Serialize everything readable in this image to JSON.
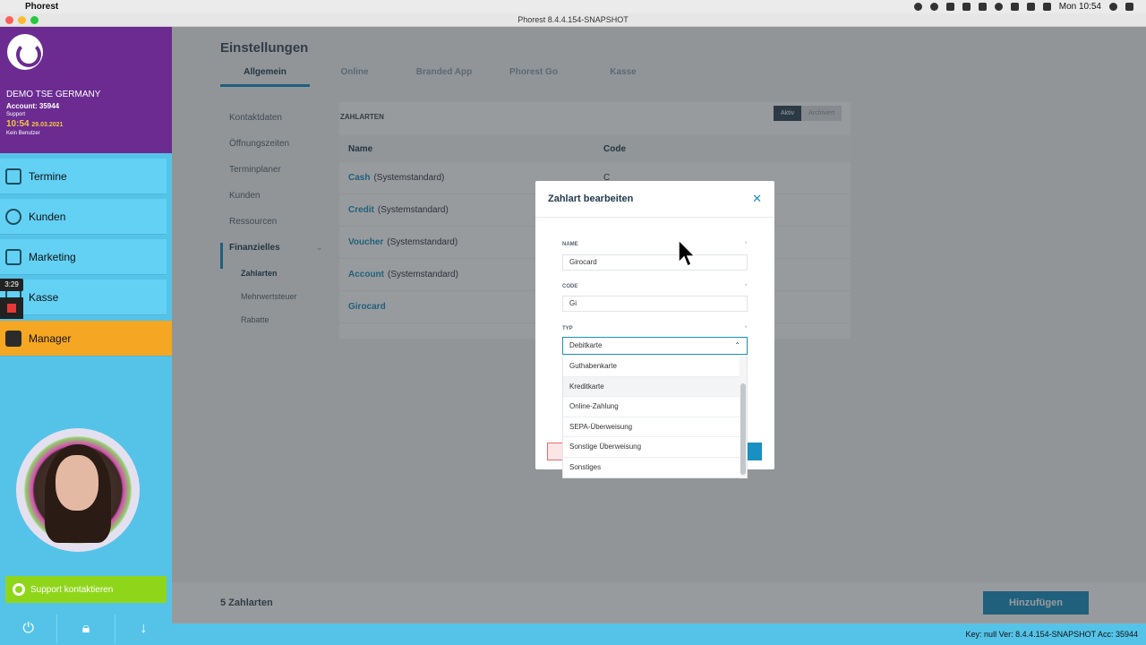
{
  "menubar": {
    "app_name": "Phorest",
    "clock": "Mon 10:54"
  },
  "window": {
    "title": "Phorest 8.4.4.154-SNAPSHOT"
  },
  "sidebar": {
    "company": "DEMO TSE GERMANY",
    "account": "Account: 35944",
    "role": "Support",
    "time": "10:54",
    "date": "29.03.2021",
    "user": "Kein Benutzer",
    "nav": [
      {
        "label": "Termine"
      },
      {
        "label": "Kunden"
      },
      {
        "label": "Marketing"
      },
      {
        "label": "Kasse"
      },
      {
        "label": "Manager"
      }
    ],
    "recording_time": "3:29",
    "support_button": "Support kontaktieren",
    "accent_manager": "#f5a623",
    "accent_head": "#6b2b91"
  },
  "main": {
    "title": "Einstellungen",
    "tabs": [
      "Allgemein",
      "Online",
      "Branded App",
      "Phorest Go",
      "Kasse"
    ],
    "subnav": {
      "items": [
        "Kontaktdaten",
        "Öffnungszeiten",
        "Terminplaner",
        "Kunden",
        "Ressourcen"
      ],
      "section": "Finanzielles",
      "children": [
        "Zahlarten",
        "Mehrwertsteuer",
        "Rabatte"
      ]
    },
    "zahlarten_header": "ZAHLARTEN",
    "toggle": {
      "active": "Aktiv",
      "archived": "Archiviert"
    },
    "table": {
      "col_name": "Name",
      "col_code": "Code",
      "rows": [
        {
          "name": "Cash",
          "suffix": "(Systemstandard)",
          "code": "C"
        },
        {
          "name": "Credit",
          "suffix": "(Systemstandard)",
          "code": ""
        },
        {
          "name": "Voucher",
          "suffix": "(Systemstandard)",
          "code": ""
        },
        {
          "name": "Account",
          "suffix": "(Systemstandard)",
          "code": ""
        },
        {
          "name": "Girocard",
          "suffix": "",
          "code": ""
        }
      ]
    },
    "footer_count": "5 Zahlarten",
    "add_button": "Hinzufügen",
    "status": "Key: null Ver: 8.4.4.154-SNAPSHOT Acc: 35944"
  },
  "modal": {
    "title": "Zahlart bearbeiten",
    "name_label": "NAME",
    "name_value": "Girocard",
    "code_label": "CODE",
    "code_value": "Gi",
    "type_label": "TYP",
    "type_value": "Debitkarte",
    "required_mark": "*",
    "options": [
      "Guthabenkarte",
      "Kreditkarte",
      "Online-Zahlung",
      "SEPA-Überweisung",
      "Sonstige Überweisung",
      "Sonstiges"
    ],
    "highlighted_option": "Kreditkarte"
  }
}
